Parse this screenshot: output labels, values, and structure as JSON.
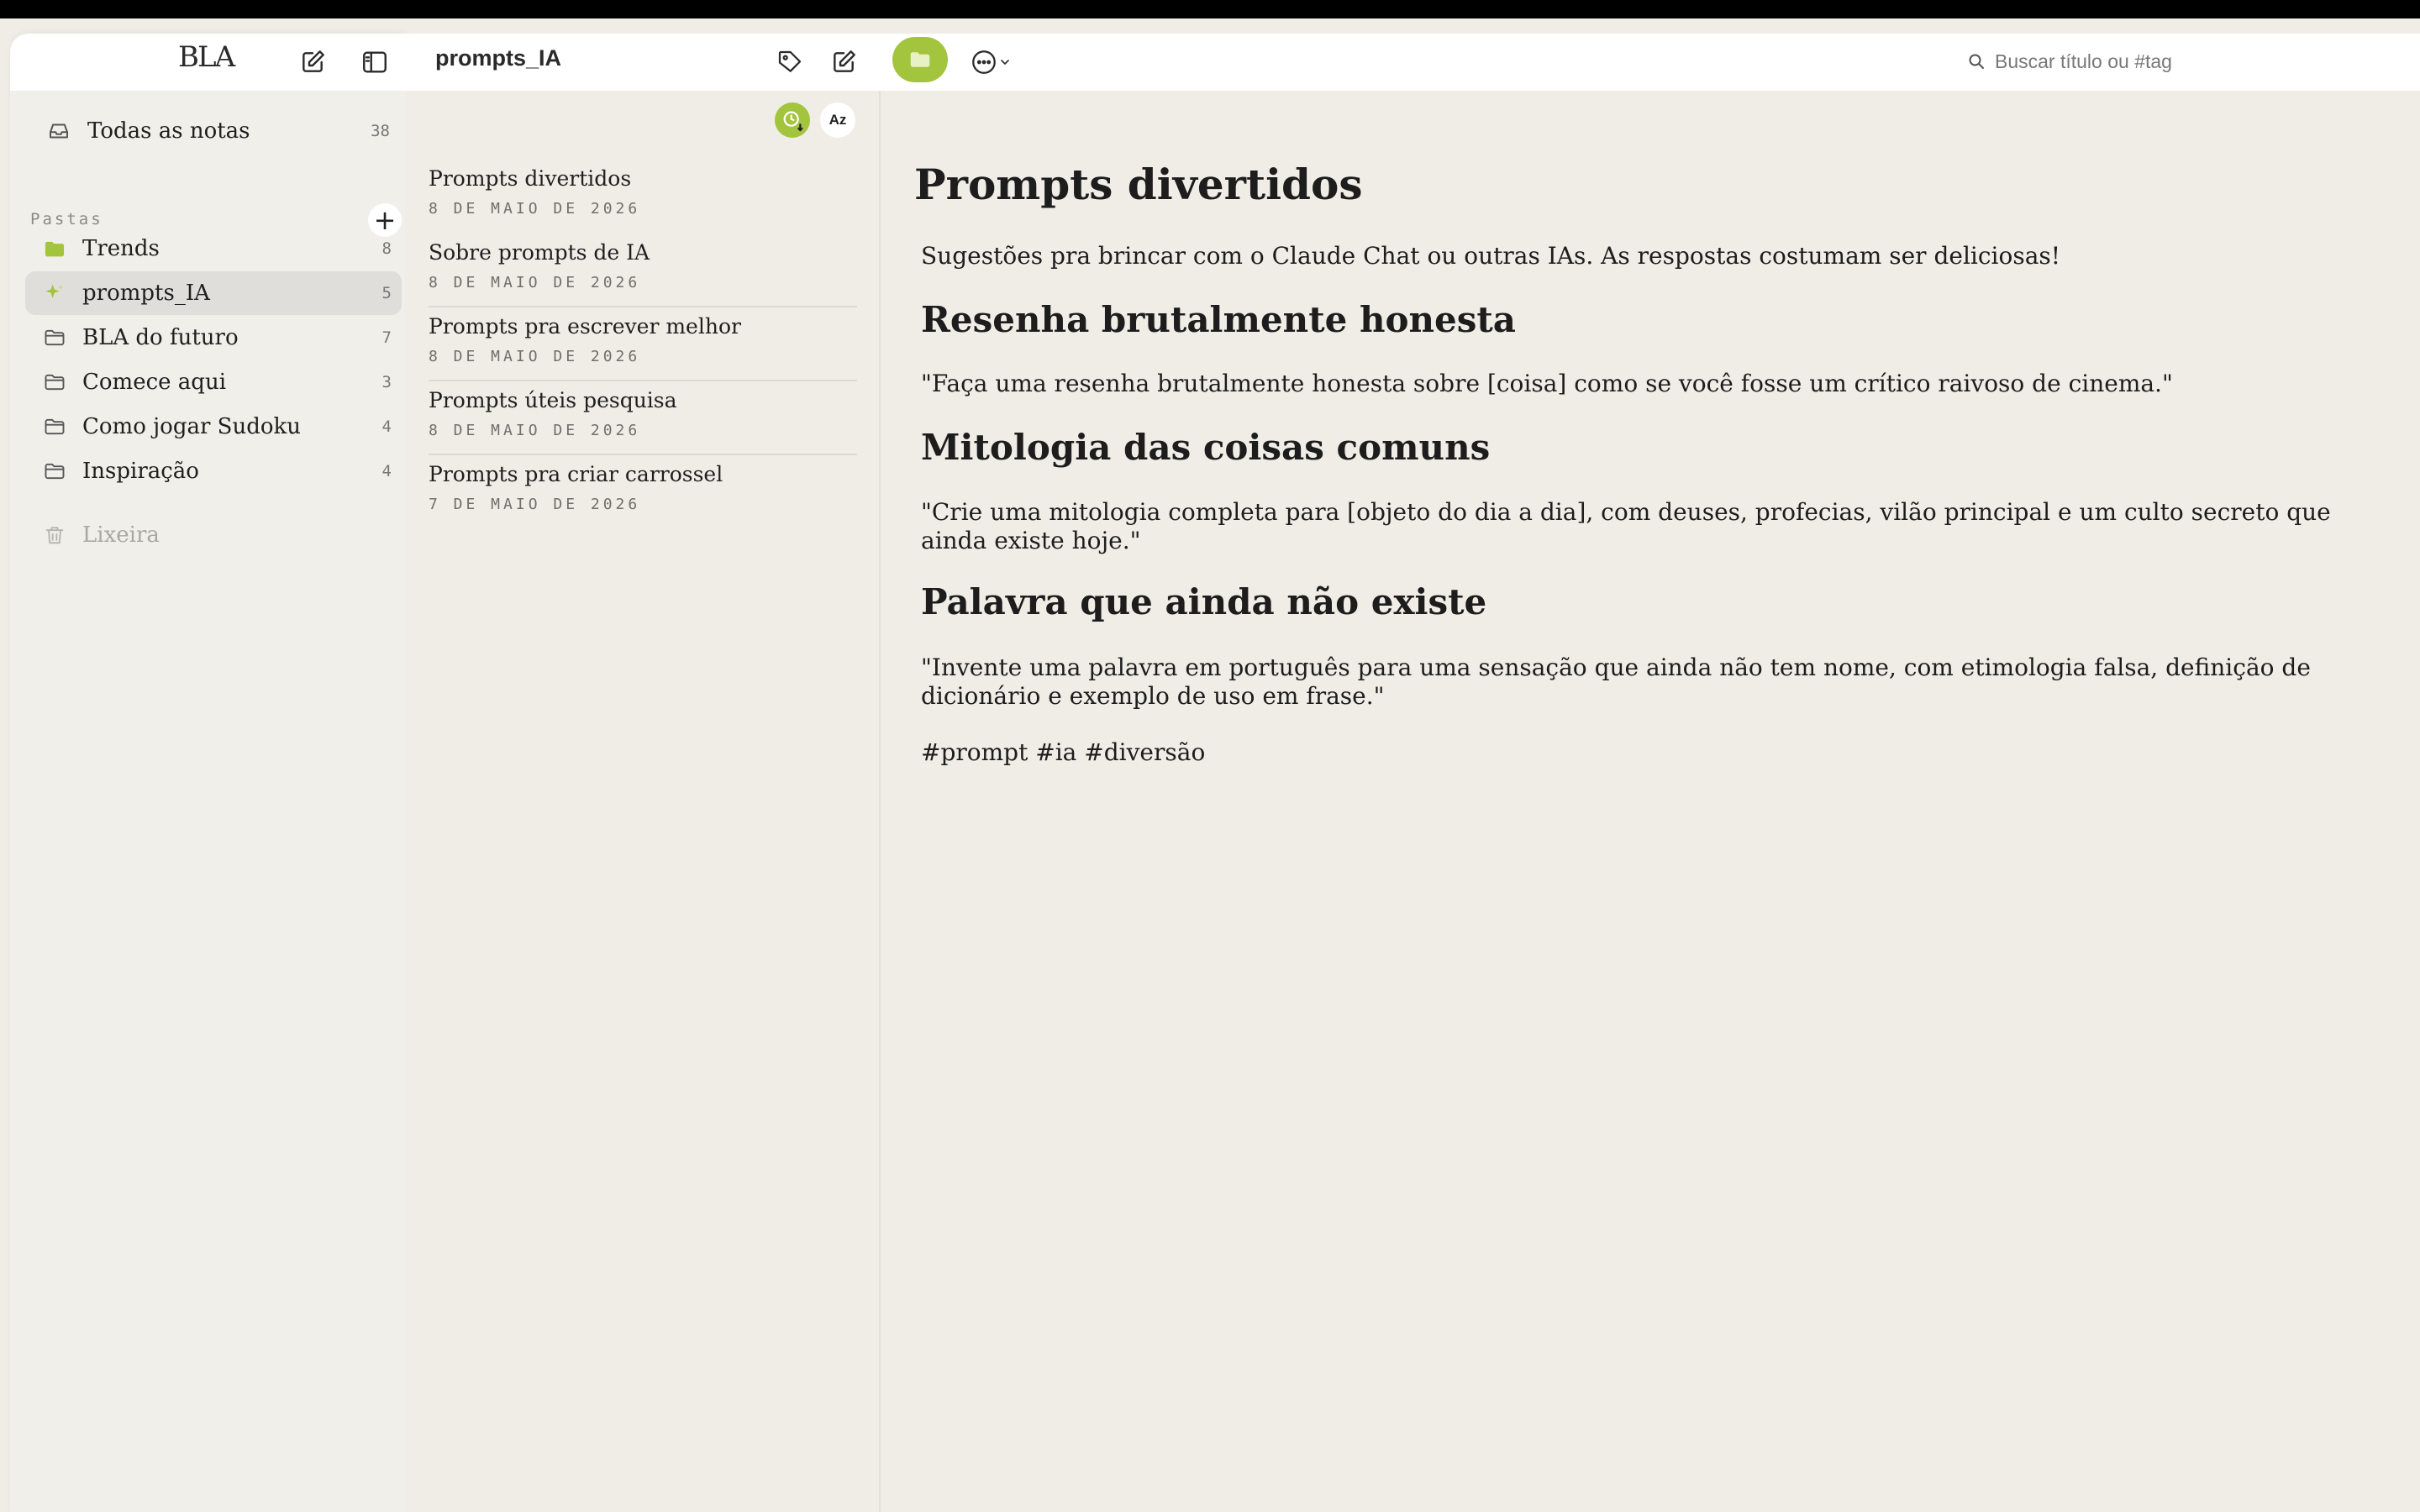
{
  "colors": {
    "accent": "#a3c43d",
    "background": "#efede6",
    "selected": "#e0deda"
  },
  "sidebar": {
    "logo": "BLA",
    "all_notes": {
      "label": "Todas as notas",
      "count": "38",
      "icon": "inbox-icon"
    },
    "section_label": "Pastas",
    "add_label": "+",
    "folders": [
      {
        "label": "Trends",
        "count": "8",
        "icon": "folder-filled-icon"
      },
      {
        "label": "prompts_IA",
        "count": "5",
        "icon": "sparkle-icon",
        "selected": true
      },
      {
        "label": "BLA do futuro",
        "count": "7",
        "icon": "folder-icon"
      },
      {
        "label": "Comece aqui",
        "count": "3",
        "icon": "folder-icon"
      },
      {
        "label": "Como jogar Sudoku",
        "count": "4",
        "icon": "folder-icon"
      },
      {
        "label": "Inspiração",
        "count": "4",
        "icon": "folder-icon"
      }
    ],
    "trash": {
      "label": "Lixeira",
      "icon": "trash-icon"
    }
  },
  "notelist": {
    "title": "prompts_IA",
    "sort_az_label": "Az",
    "notes": [
      {
        "title": "Prompts divertidos",
        "date": "8 DE MAIO DE 2026"
      },
      {
        "title": "Sobre prompts de IA",
        "date": "8 DE MAIO DE 2026"
      },
      {
        "title": "Prompts pra escrever melhor",
        "date": "8 DE MAIO DE 2026"
      },
      {
        "title": "Prompts úteis pesquisa",
        "date": "8 DE MAIO DE 2026"
      },
      {
        "title": "Prompts pra criar carrossel",
        "date": "7 DE MAIO DE 2026"
      }
    ]
  },
  "editor": {
    "search_placeholder": "Buscar título ou #tag",
    "title": "Prompts divertidos",
    "intro": "Sugestões pra brincar com o Claude Chat ou outras IAs. As respostas costumam ser deliciosas!",
    "sections": [
      {
        "heading": "Resenha brutalmente honesta",
        "body": "\"Faça uma resenha brutalmente honesta sobre [coisa] como se você fosse um crítico raivoso de cinema.\""
      },
      {
        "heading": "Mitologia das coisas comuns",
        "body": "\"Crie uma mitologia completa para [objeto do dia a dia], com deuses, profecias, vilão principal e um culto secreto que ainda existe hoje.\""
      },
      {
        "heading": "Palavra que ainda não existe",
        "body": "\"Invente uma palavra em português para uma sensação que ainda não tem nome, com etimologia falsa, definição de dicionário e exemplo de uso em frase.\""
      }
    ],
    "tags": "#prompt #ia #diversão"
  }
}
